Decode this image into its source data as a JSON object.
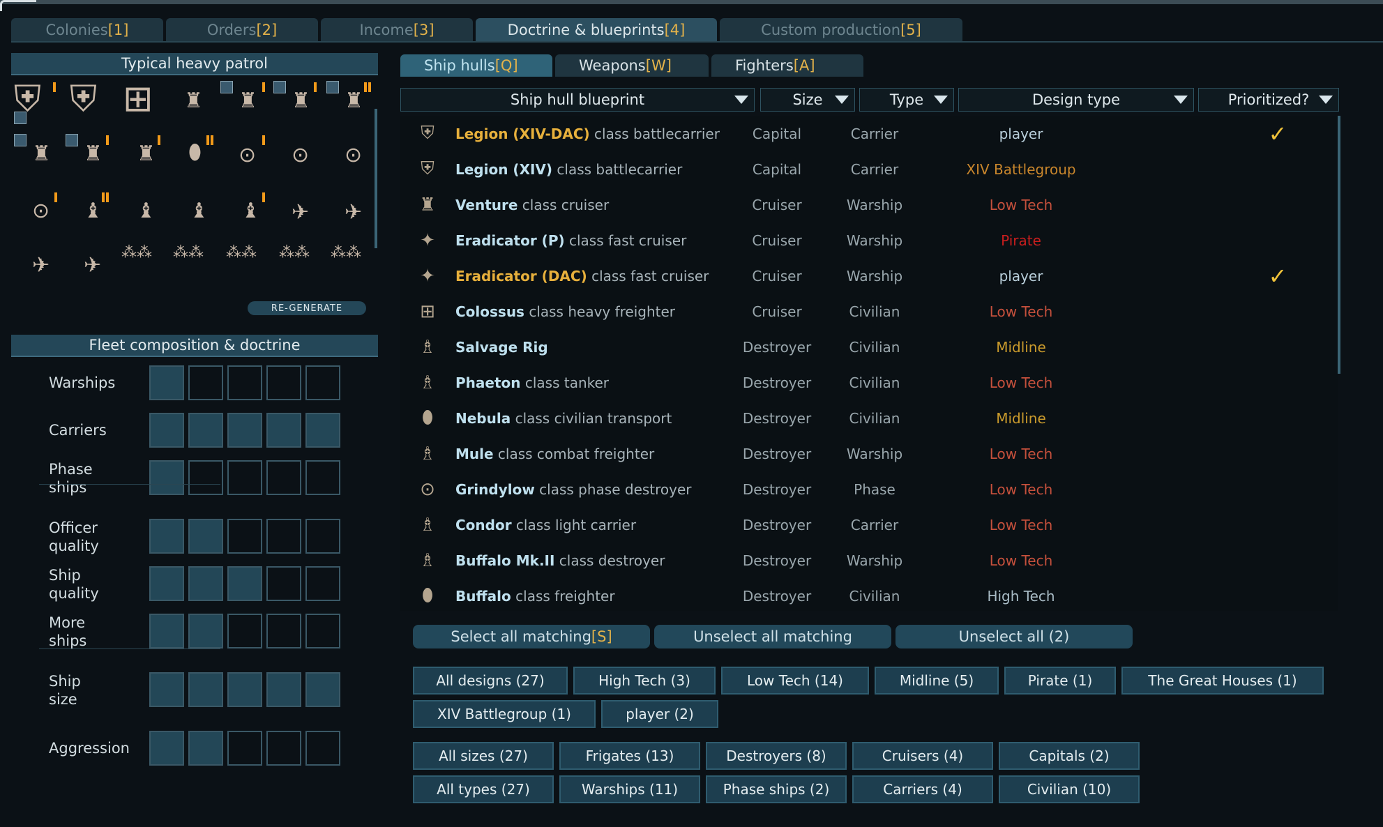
{
  "main_tabs": [
    {
      "label": "Colonies ",
      "key": "[1]",
      "active": false
    },
    {
      "label": "Orders ",
      "key": "[2]",
      "active": false
    },
    {
      "label": "Income ",
      "key": "[3]",
      "active": false
    },
    {
      "label": "Doctrine & blueprints ",
      "key": "[4]",
      "active": true
    },
    {
      "label": "Custom production ",
      "key": "[5]",
      "active": false
    }
  ],
  "left": {
    "patrol_title": "Typical heavy patrol",
    "regenerate_label": "RE-GENERATE",
    "doctrine_title": "Fleet composition & doctrine",
    "doctrine_rows": [
      {
        "label": "Warships",
        "level": 1
      },
      {
        "label": "Carriers",
        "level": 5
      },
      {
        "label": "Phase\nships",
        "level": 1
      },
      {
        "label": "Officer\nquality",
        "level": 2
      },
      {
        "label": "Ship\nquality",
        "level": 3
      },
      {
        "label": "More\nships",
        "level": 2
      },
      {
        "label": "Ship\nsize",
        "level": 5
      },
      {
        "label": "Aggression",
        "level": 2
      }
    ]
  },
  "sub_tabs": [
    {
      "label": "Ship hulls ",
      "key": "[Q]",
      "active": true
    },
    {
      "label": "Weapons ",
      "key": "[W]",
      "active": false
    },
    {
      "label": "Fighters ",
      "key": "[A]",
      "active": false
    }
  ],
  "columns": {
    "hull": "Ship hull blueprint",
    "size": "Size",
    "type": "Type",
    "design": "Design type",
    "prioritized": "Prioritized?"
  },
  "rows": [
    {
      "name": "Legion (XIV-DAC)",
      "cls": " class battlecarrier",
      "size": "Capital",
      "type": "Carrier",
      "design": "player",
      "prio": true,
      "player": true,
      "design_color": "#b9cfdb"
    },
    {
      "name": "Legion (XIV)",
      "cls": " class battlecarrier",
      "size": "Capital",
      "type": "Carrier",
      "design": "XIV Battlegroup",
      "prio": false,
      "player": false,
      "design_color": "#c9862c"
    },
    {
      "name": "Venture",
      "cls": " class cruiser",
      "size": "Cruiser",
      "type": "Warship",
      "design": "Low Tech",
      "prio": false,
      "player": false,
      "design_color": "#c5503c"
    },
    {
      "name": "Eradicator (P)",
      "cls": " class fast cruiser",
      "size": "Cruiser",
      "type": "Warship",
      "design": "Pirate",
      "prio": false,
      "player": false,
      "design_color": "#c81e1e"
    },
    {
      "name": "Eradicator (DAC)",
      "cls": " class fast cruiser",
      "size": "Cruiser",
      "type": "Warship",
      "design": "player",
      "prio": true,
      "player": true,
      "design_color": "#b9cfdb"
    },
    {
      "name": "Colossus",
      "cls": " class heavy freighter",
      "size": "Cruiser",
      "type": "Civilian",
      "design": "Low Tech",
      "prio": false,
      "player": false,
      "design_color": "#c5503c"
    },
    {
      "name": "Salvage Rig",
      "cls": "",
      "size": "Destroyer",
      "type": "Civilian",
      "design": "Midline",
      "prio": false,
      "player": false,
      "design_color": "#c99a2c"
    },
    {
      "name": "Phaeton",
      "cls": " class tanker",
      "size": "Destroyer",
      "type": "Civilian",
      "design": "Low Tech",
      "prio": false,
      "player": false,
      "design_color": "#c5503c"
    },
    {
      "name": "Nebula",
      "cls": " class civilian transport",
      "size": "Destroyer",
      "type": "Civilian",
      "design": "Midline",
      "prio": false,
      "player": false,
      "design_color": "#c99a2c"
    },
    {
      "name": "Mule",
      "cls": " class combat freighter",
      "size": "Destroyer",
      "type": "Warship",
      "design": "Low Tech",
      "prio": false,
      "player": false,
      "design_color": "#c5503c"
    },
    {
      "name": "Grindylow",
      "cls": " class phase destroyer",
      "size": "Destroyer",
      "type": "Phase",
      "design": "Low Tech",
      "prio": false,
      "player": false,
      "design_color": "#c5503c"
    },
    {
      "name": "Condor",
      "cls": " class light carrier",
      "size": "Destroyer",
      "type": "Carrier",
      "design": "Low Tech",
      "prio": false,
      "player": false,
      "design_color": "#c5503c"
    },
    {
      "name": "Buffalo Mk.II",
      "cls": " class destroyer",
      "size": "Destroyer",
      "type": "Warship",
      "design": "Low Tech",
      "prio": false,
      "player": false,
      "design_color": "#c5503c"
    },
    {
      "name": "Buffalo",
      "cls": " class freighter",
      "size": "Destroyer",
      "type": "Civilian",
      "design": "High Tech",
      "prio": false,
      "player": false,
      "design_color": "#a9bcc6"
    }
  ],
  "check_glyph": "✓",
  "select_buttons": {
    "select_all": "Select all matching ",
    "select_all_key": "[S]",
    "unselect_matching": "Unselect all matching",
    "unselect_all": "Unselect all  (2)"
  },
  "filters": {
    "design": [
      "All designs (27)",
      "High Tech (3)",
      "Low Tech (14)",
      "Midline (5)",
      "Pirate (1)",
      "The Great Houses (1)"
    ],
    "design2": [
      "XIV Battlegroup (1)",
      "player (2)"
    ],
    "sizes": [
      "All sizes (27)",
      "Frigates (13)",
      "Destroyers (8)",
      "Cruisers (4)",
      "Capitals (2)"
    ],
    "types": [
      "All types (27)",
      "Warships (11)",
      "Phase ships (2)",
      "Carriers (4)",
      "Civilian (10)"
    ]
  }
}
